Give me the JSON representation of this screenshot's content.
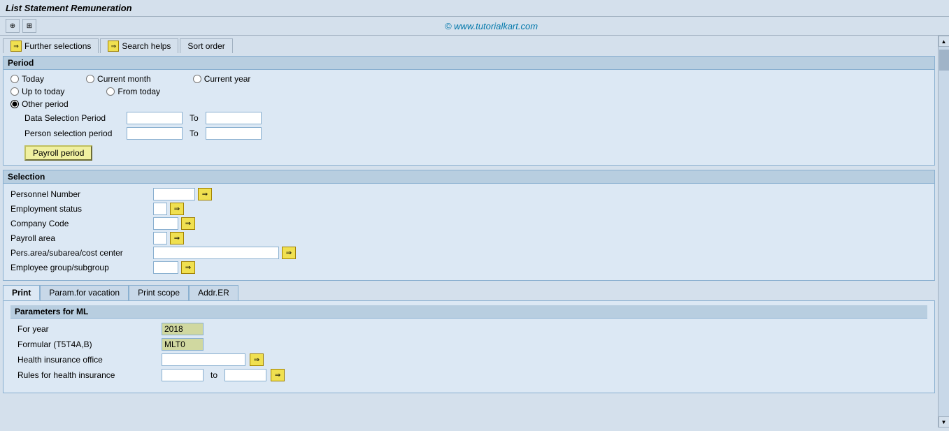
{
  "title": "List  Statement Remuneration",
  "watermark": "© www.tutorialkart.com",
  "toolbar": {
    "icons": [
      "back-icon",
      "grid-icon"
    ]
  },
  "tabs": [
    {
      "label": "Further selections",
      "has_arrow": true
    },
    {
      "label": "Search helps",
      "has_arrow": true
    },
    {
      "label": "Sort order",
      "has_arrow": false
    }
  ],
  "period_section": {
    "header": "Period",
    "radio_options": [
      {
        "label": "Today",
        "name": "period",
        "value": "today",
        "checked": false
      },
      {
        "label": "Current month",
        "name": "period",
        "value": "current_month",
        "checked": false
      },
      {
        "label": "Current year",
        "name": "period",
        "value": "current_year",
        "checked": false
      },
      {
        "label": "Up to today",
        "name": "period",
        "value": "up_to_today",
        "checked": false
      },
      {
        "label": "From today",
        "name": "period",
        "value": "from_today",
        "checked": false
      },
      {
        "label": "Other period",
        "name": "period",
        "value": "other_period",
        "checked": true
      }
    ],
    "fields": [
      {
        "label": "Data Selection Period",
        "to_label": "To"
      },
      {
        "label": "Person selection period",
        "to_label": "To"
      }
    ],
    "payroll_button": "Payroll period"
  },
  "selection_section": {
    "header": "Selection",
    "fields": [
      {
        "label": "Personnel Number",
        "input_wide": false,
        "has_arrow": true
      },
      {
        "label": "Employment status",
        "input_wide": false,
        "has_arrow": true
      },
      {
        "label": "Company Code",
        "input_wide": false,
        "has_arrow": true
      },
      {
        "label": "Payroll area",
        "input_wide": false,
        "has_arrow": true
      },
      {
        "label": "Pers.area/subarea/cost center",
        "input_wide": true,
        "has_arrow": true
      },
      {
        "label": "Employee group/subgroup",
        "input_wide": false,
        "has_arrow": true
      }
    ]
  },
  "bottom_tabs": [
    {
      "label": "Print",
      "active": true
    },
    {
      "label": "Param.for vacation",
      "active": false
    },
    {
      "label": "Print scope",
      "active": false
    },
    {
      "label": "Addr.ER",
      "active": false
    }
  ],
  "parameters_section": {
    "header": "Parameters for ML",
    "fields": [
      {
        "label": "For year",
        "value": "2018",
        "colored": true
      },
      {
        "label": "Formular (T5T4A,B)",
        "value": "MLT0",
        "colored": true
      },
      {
        "label": "Health insurance office",
        "value": "",
        "has_arrow": true
      },
      {
        "label": "Rules for health insurance",
        "to_label": "to",
        "has_arrow": true
      }
    ]
  },
  "scrollbar": {
    "up_arrow": "▲",
    "down_arrow": "▼",
    "right_arrows": [
      "►",
      "◄"
    ]
  }
}
